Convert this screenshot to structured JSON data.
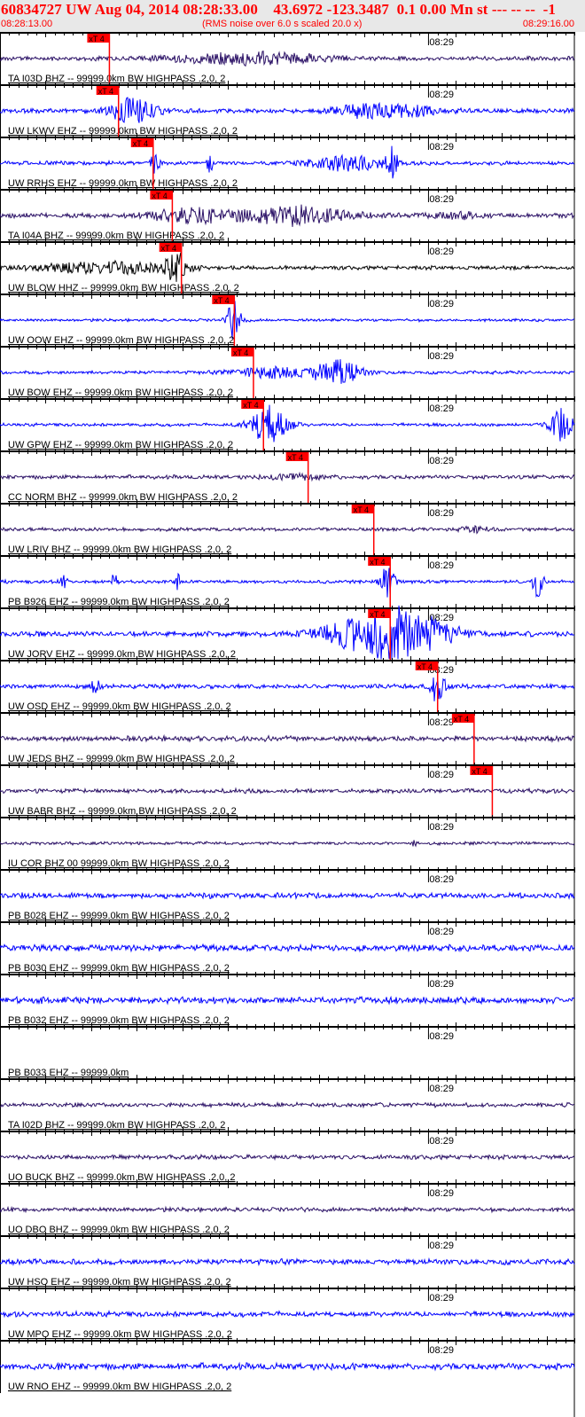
{
  "header": {
    "title": "60834727 UW Aug 04, 2014 08:28:33.00    43.6972 -123.3487  0.1 0.00 Mn st --- -- --  -1",
    "start_time": "08:28:13.00",
    "end_time": "08:29:16.00",
    "note": "(RMS noise over 6.0 s scaled 20.0 x)"
  },
  "colors": {
    "header_text": "#ff0000",
    "header_bg": "#e8e8e8",
    "pick": "#ff0000",
    "blue": "#0000ff",
    "purple": "#2b1166",
    "black": "#000000"
  },
  "chart_data": {
    "type": "line",
    "title": "60834727 UW Aug 04, 2014 08:28:33.00",
    "x_range_seconds": [
      0,
      63
    ],
    "x_start": "08:28:13.00",
    "x_end": "08:29:16.00",
    "minute_mark": {
      "label": "08:29",
      "seconds": 47
    },
    "pick_label": "xT 4",
    "stations": [
      {
        "label": "TA I03D BHZ -- 99999.0km BW  HIGHPASS  .2,0, 2",
        "color": "purple",
        "noise": 2,
        "pick": 12.0,
        "bursts": [
          [
            25,
            4,
            8
          ],
          [
            31,
            3,
            6
          ]
        ]
      },
      {
        "label": "UW LKWV EHZ -- 99999.0km BW  HIGHPASS  .2,0, 2",
        "color": "blue",
        "noise": 2.2,
        "pick": 13.0,
        "bursts": [
          [
            14.5,
            13,
            2.5
          ],
          [
            40,
            7,
            3
          ],
          [
            45,
            6,
            2.5
          ]
        ]
      },
      {
        "label": "UW RRHS EHZ -- 99999.0km BW  HIGHPASS  .2,0, 2",
        "color": "blue",
        "noise": 1.8,
        "pick": 16.8,
        "bursts": [
          [
            17,
            15,
            0.4
          ],
          [
            23,
            10,
            0.3
          ],
          [
            38,
            8,
            4
          ],
          [
            43,
            16,
            0.6
          ]
        ]
      },
      {
        "label": "TA I04A BHZ -- 99999.0km BW  HIGHPASS  .2,0, 2",
        "color": "purple",
        "noise": 2.2,
        "pick": 18.9,
        "bursts": [
          [
            21,
            8,
            4
          ],
          [
            32,
            10,
            6
          ],
          [
            50,
            3,
            3
          ]
        ]
      },
      {
        "label": "UW BLOW HHZ -- 99999.0km BW  HIGHPASS  .2,0, 2",
        "color": "black",
        "noise": 1.8,
        "pick": 19.9,
        "bursts": [
          [
            19.5,
            16,
            1.5
          ],
          [
            8,
            4,
            5
          ],
          [
            14,
            5,
            4
          ]
        ]
      },
      {
        "label": "UW OOW EHZ -- 99999.0km BW  HIGHPASS  .2,0, 2",
        "color": "blue",
        "noise": 1.3,
        "pick": 25.7,
        "bursts": [
          [
            25.7,
            22,
            0.8
          ]
        ]
      },
      {
        "label": "UW BOW EHZ -- 99999.0km BW  HIGHPASS  .2,0, 2",
        "color": "blue",
        "noise": 1.5,
        "pick": 27.8,
        "bursts": [
          [
            30,
            6,
            4
          ],
          [
            37,
            14,
            2.5
          ]
        ]
      },
      {
        "label": "UW GPW EHZ -- 99999.0km BW  HIGHPASS  .2,0, 2",
        "color": "blue",
        "noise": 1.5,
        "pick": 28.9,
        "bursts": [
          [
            29.5,
            24,
            2
          ],
          [
            61.5,
            17,
            1.2
          ]
        ]
      },
      {
        "label": "CC NORM BHZ -- 99999.0km BW  HIGHPASS  .2,0, 2",
        "color": "purple",
        "noise": 1.8,
        "pick": 33.8,
        "bursts": [
          [
            33,
            3,
            3
          ]
        ]
      },
      {
        "label": "UW LRIV BHZ -- 99999.0km BW  HIGHPASS  .2,0, 2",
        "color": "purple",
        "noise": 1.6,
        "pick": 41.0,
        "bursts": [
          [
            52,
            3,
            1.5
          ]
        ]
      },
      {
        "label": "PB B926 EHZ -- 99999.0km BW  HIGHPASS  .2,0, 2",
        "color": "blue",
        "noise": 1.5,
        "pick": 42.8,
        "bursts": [
          [
            42.5,
            18,
            0.8
          ],
          [
            59,
            17,
            0.6
          ],
          [
            7,
            7,
            0.4
          ],
          [
            12.5,
            8,
            0.4
          ],
          [
            19.5,
            8,
            0.4
          ]
        ]
      },
      {
        "label": "UW JORV EHZ -- 99999.0km BW  HIGHPASS  .2,0, 2",
        "color": "blue",
        "noise": 2.5,
        "pick": 42.8,
        "bursts": [
          [
            44,
            28,
            5
          ],
          [
            38,
            8,
            4
          ]
        ]
      },
      {
        "label": "UW OSD EHZ -- 99999.0km BW  HIGHPASS  .2,0, 2",
        "color": "blue",
        "noise": 2,
        "pick": 48.0,
        "bursts": [
          [
            10.5,
            12,
            0.4
          ],
          [
            48,
            18,
            0.8
          ]
        ]
      },
      {
        "label": "UW JEDS BHZ -- 99999.0km BW  HIGHPASS  .2,0, 2",
        "color": "purple",
        "noise": 2.5,
        "pick": 52.0,
        "bursts": []
      },
      {
        "label": "UW BABR BHZ -- 99999.0km BW  HIGHPASS  .2,0, 2",
        "color": "purple",
        "noise": 2,
        "pick": 54.0,
        "bursts": []
      },
      {
        "label": "IU COR BHZ 00 99999.0km BW  HIGHPASS  .2,0, 2",
        "color": "purple",
        "noise": 1.5,
        "pick": null,
        "bursts": [
          [
            45.5,
            4,
            0.3
          ]
        ]
      },
      {
        "label": "PB B028 EHZ -- 99999.0km BW  HIGHPASS  .2,0, 2",
        "color": "blue",
        "noise": 2.5,
        "pick": null,
        "bursts": []
      },
      {
        "label": "PB B030 EHZ -- 99999.0km BW  HIGHPASS  .2,0, 2",
        "color": "blue",
        "noise": 3,
        "pick": null,
        "bursts": []
      },
      {
        "label": "PB B032 EHZ -- 99999.0km BW  HIGHPASS  .2,0, 2",
        "color": "blue",
        "noise": 3,
        "pick": null,
        "bursts": []
      },
      {
        "label": "PB B033 EHZ -- 99999.0km",
        "color": "none",
        "noise": 0,
        "pick": null,
        "bursts": []
      },
      {
        "label": "TA I02D BHZ -- 99999.0km BW  HIGHPASS  .2,0, 2",
        "color": "purple",
        "noise": 2,
        "pick": null,
        "bursts": []
      },
      {
        "label": "UO BUCK BHZ -- 99999.0km BW  HIGHPASS  .2,0, 2",
        "color": "purple",
        "noise": 2,
        "pick": null,
        "bursts": []
      },
      {
        "label": "UO DBO BHZ -- 99999.0km BW  HIGHPASS  .2,0, 2",
        "color": "purple",
        "noise": 2,
        "pick": null,
        "bursts": []
      },
      {
        "label": "UW HSO EHZ -- 99999.0km BW  HIGHPASS  .2,0, 2",
        "color": "blue",
        "noise": 2.5,
        "pick": null,
        "bursts": []
      },
      {
        "label": "UW MPO EHZ -- 99999.0km BW  HIGHPASS  .2,0, 2",
        "color": "blue",
        "noise": 2.5,
        "pick": null,
        "bursts": []
      },
      {
        "label": "UW RNO EHZ -- 99999.0km BW  HIGHPASS  .2,0, 2",
        "color": "blue",
        "noise": 3,
        "pick": null,
        "bursts": []
      }
    ]
  }
}
